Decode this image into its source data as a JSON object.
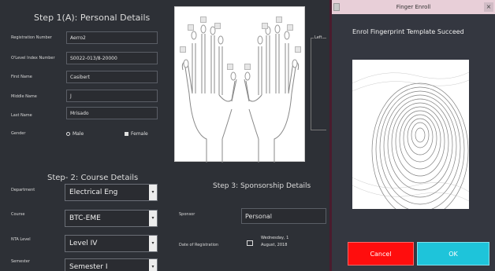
{
  "step1": {
    "title": "Step 1(A): Personal Details",
    "registration_label": "Registration Number",
    "registration_value": "Aerro2",
    "olevel_label": "O'Level Index Number",
    "olevel_value": "S0022-013/8-20000",
    "first_name_label": "First Name",
    "first_name_value": "Casibert",
    "middle_name_label": "Middle Name",
    "middle_name_value": "J",
    "last_name_label": "Last Name",
    "last_name_value": "Mrisado",
    "gender_label": "Gender",
    "gender_male": "Male",
    "gender_female": "Female"
  },
  "step2": {
    "title": "Step- 2: Course Details",
    "department_label": "Department",
    "department_value": "Electrical Eng",
    "course_label": "Course",
    "course_value": "BTC-EME",
    "nta_label": "NTA Level",
    "nta_value": "Level IV",
    "semester_label": "Semester",
    "semester_value": "Semester I"
  },
  "step3": {
    "title": "Step 3: Sponsorship Details",
    "sponsor_label": "Sponsor",
    "sponsor_value": "Personal",
    "date_label": "Date of Registration",
    "date_line1": "Wednesday, 1",
    "date_line2": "August, 2018"
  },
  "legend": {
    "label": "Left"
  },
  "dialog": {
    "title": "Finger Enroll",
    "close_glyph": "×",
    "message": "Enrol Fingerprint Template Succeed",
    "cancel_label": "Cancel",
    "ok_label": "OK"
  },
  "icons": {
    "calendar": "calendar-icon",
    "dropdown": "chevron-down-icon"
  },
  "colors": {
    "cancel": "#ff0d0d",
    "ok": "#1ec4da",
    "background": "#2d3036"
  }
}
